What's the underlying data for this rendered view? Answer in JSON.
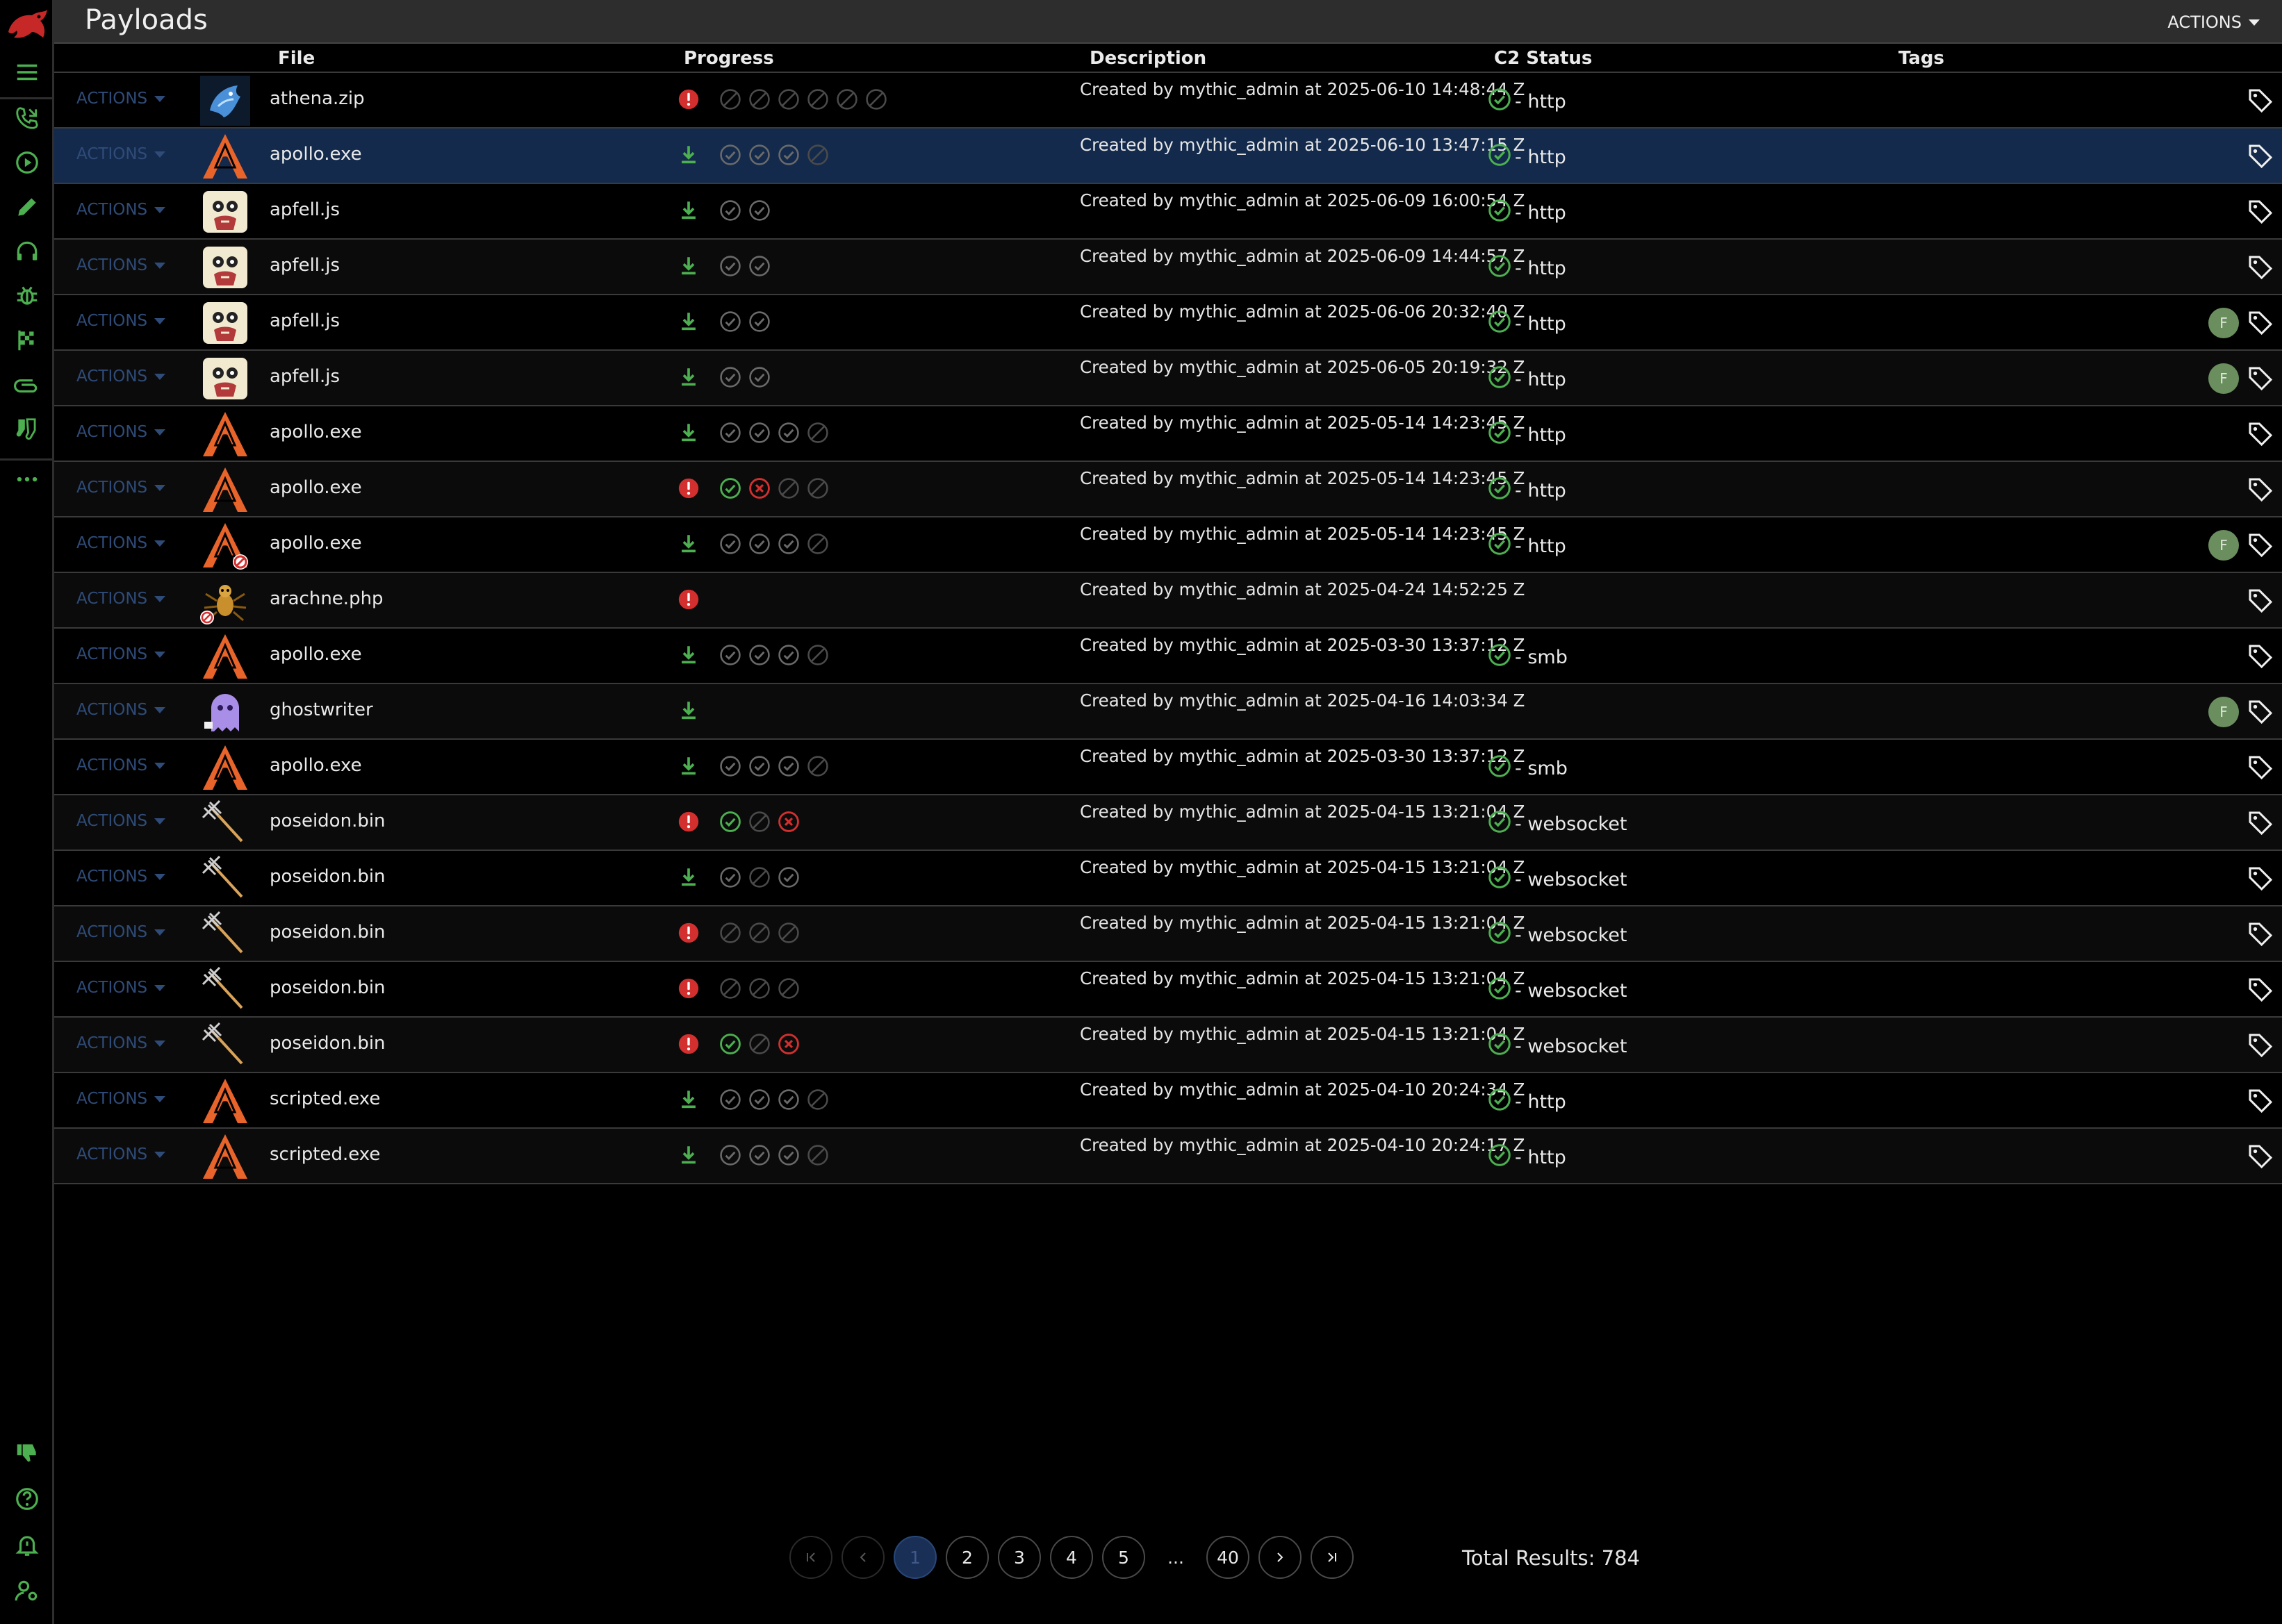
{
  "app": {
    "title": "Payloads",
    "actions_label": "ACTIONS"
  },
  "columns": {
    "file": "File",
    "progress": "Progress",
    "description": "Description",
    "c2": "C2 Status",
    "tags": "Tags"
  },
  "sidebar": {
    "icons": [
      "mythic-logo-icon",
      "menu-icon",
      "callbacks-phone-icon",
      "play-circle-icon",
      "pencil-icon",
      "headset-icon",
      "bug-icon",
      "flag-checkered-icon",
      "paperclip-icon",
      "socks-icon",
      "more-icon"
    ],
    "bottom_icons": [
      "thumbs-down-icon",
      "help-circle-icon",
      "bell-alert-icon",
      "user-settings-icon"
    ]
  },
  "row_action_label": "ACTIONS",
  "payloads": [
    {
      "file": "athena.zip",
      "agent": "athena",
      "lead": "error",
      "steps": [
        "skip",
        "skip",
        "skip",
        "skip",
        "skip",
        "skip"
      ],
      "desc": "Created by mythic_admin at 2025-06-10 14:48:44 Z",
      "c2": "- http",
      "tag": "",
      "selected": false
    },
    {
      "file": "apollo.exe",
      "agent": "apollo",
      "lead": "download",
      "steps": [
        "ok",
        "ok",
        "ok",
        "skip"
      ],
      "desc": "Created by mythic_admin at 2025-06-10 13:47:15 Z",
      "c2": "- http",
      "tag": "",
      "selected": true
    },
    {
      "file": "apfell.js",
      "agent": "apfell",
      "lead": "download",
      "steps": [
        "ok",
        "ok"
      ],
      "desc": "Created by mythic_admin at 2025-06-09 16:00:54 Z",
      "c2": "- http",
      "tag": "",
      "selected": false
    },
    {
      "file": "apfell.js",
      "agent": "apfell",
      "lead": "download",
      "steps": [
        "ok",
        "ok"
      ],
      "desc": "Created by mythic_admin at 2025-06-09 14:44:57 Z",
      "c2": "- http",
      "tag": "",
      "selected": false
    },
    {
      "file": "apfell.js",
      "agent": "apfell",
      "lead": "download",
      "steps": [
        "ok",
        "ok"
      ],
      "desc": "Created by mythic_admin at 2025-06-06 20:32:40 Z",
      "c2": "- http",
      "tag": "F",
      "selected": false
    },
    {
      "file": "apfell.js",
      "agent": "apfell",
      "lead": "download",
      "steps": [
        "ok",
        "ok"
      ],
      "desc": "Created by mythic_admin at 2025-06-05 20:19:32 Z",
      "c2": "- http",
      "tag": "F",
      "selected": false
    },
    {
      "file": "apollo.exe",
      "agent": "apollo",
      "lead": "download",
      "steps": [
        "ok",
        "ok",
        "ok",
        "skip"
      ],
      "desc": "Created by mythic_admin at 2025-05-14 14:23:45 Z",
      "c2": "- http",
      "tag": "",
      "selected": false
    },
    {
      "file": "apollo.exe",
      "agent": "apollo",
      "lead": "error",
      "steps": [
        "success",
        "fail",
        "skip",
        "skip"
      ],
      "desc": "Created by mythic_admin at 2025-05-14 14:23:45 Z",
      "c2": "- http",
      "tag": "",
      "selected": false
    },
    {
      "file": "apollo.exe",
      "agent": "apollo-blocked",
      "lead": "download",
      "steps": [
        "ok",
        "ok",
        "ok",
        "skip"
      ],
      "desc": "Created by mythic_admin at 2025-05-14 14:23:45 Z",
      "c2": "- http",
      "tag": "F",
      "selected": false
    },
    {
      "file": "arachne.php",
      "agent": "arachne",
      "lead": "error",
      "steps": [],
      "desc": "Created by mythic_admin at 2025-04-24 14:52:25 Z",
      "c2": "",
      "tag": "",
      "selected": false
    },
    {
      "file": "apollo.exe",
      "agent": "apollo",
      "lead": "download",
      "steps": [
        "ok",
        "ok",
        "ok",
        "skip"
      ],
      "desc": "Created by mythic_admin at 2025-03-30 13:37:12 Z",
      "c2": "- smb",
      "tag": "",
      "selected": false
    },
    {
      "file": "ghostwriter",
      "agent": "ghostwriter",
      "lead": "download",
      "steps": [],
      "desc": "Created by mythic_admin at 2025-04-16 14:03:34 Z",
      "c2": "",
      "tag": "F",
      "selected": false
    },
    {
      "file": "apollo.exe",
      "agent": "apollo",
      "lead": "download",
      "steps": [
        "ok",
        "ok",
        "ok",
        "skip"
      ],
      "desc": "Created by mythic_admin at 2025-03-30 13:37:12 Z",
      "c2": "- smb",
      "tag": "",
      "selected": false
    },
    {
      "file": "poseidon.bin",
      "agent": "poseidon",
      "lead": "error",
      "steps": [
        "success",
        "skip",
        "fail"
      ],
      "desc": "Created by mythic_admin at 2025-04-15 13:21:04 Z",
      "c2": "- websocket",
      "tag": "",
      "selected": false
    },
    {
      "file": "poseidon.bin",
      "agent": "poseidon",
      "lead": "download",
      "steps": [
        "ok",
        "skip",
        "ok"
      ],
      "desc": "Created by mythic_admin at 2025-04-15 13:21:04 Z",
      "c2": "- websocket",
      "tag": "",
      "selected": false
    },
    {
      "file": "poseidon.bin",
      "agent": "poseidon",
      "lead": "error",
      "steps": [
        "skip",
        "skip",
        "skip"
      ],
      "desc": "Created by mythic_admin at 2025-04-15 13:21:04 Z",
      "c2": "- websocket",
      "tag": "",
      "selected": false
    },
    {
      "file": "poseidon.bin",
      "agent": "poseidon",
      "lead": "error",
      "steps": [
        "skip",
        "skip",
        "skip"
      ],
      "desc": "Created by mythic_admin at 2025-04-15 13:21:04 Z",
      "c2": "- websocket",
      "tag": "",
      "selected": false
    },
    {
      "file": "poseidon.bin",
      "agent": "poseidon",
      "lead": "error",
      "steps": [
        "success",
        "skip",
        "fail"
      ],
      "desc": "Created by mythic_admin at 2025-04-15 13:21:04 Z",
      "c2": "- websocket",
      "tag": "",
      "selected": false
    },
    {
      "file": "scripted.exe",
      "agent": "apollo",
      "lead": "download",
      "steps": [
        "ok",
        "ok",
        "ok",
        "skip"
      ],
      "desc": "Created by mythic_admin at 2025-04-10 20:24:34 Z",
      "c2": "- http",
      "tag": "",
      "selected": false
    },
    {
      "file": "scripted.exe",
      "agent": "apollo",
      "lead": "download",
      "steps": [
        "ok",
        "ok",
        "ok",
        "skip"
      ],
      "desc": "Created by mythic_admin at 2025-04-10 20:24:17 Z",
      "c2": "- http",
      "tag": "",
      "selected": false
    }
  ],
  "pagination": {
    "pages": [
      "1",
      "2",
      "3",
      "4",
      "5"
    ],
    "ellipsis": "...",
    "last_page": "40",
    "current": "1",
    "total": "Total Results: 784"
  },
  "colors": {
    "background": "#000000",
    "titlebar": "#2d2d2d",
    "selected_row": "#132a4c",
    "success": "#4caf50",
    "error": "#d32f2f",
    "accent": "#2f4b78",
    "tag_badge": "#6b8e5f"
  }
}
